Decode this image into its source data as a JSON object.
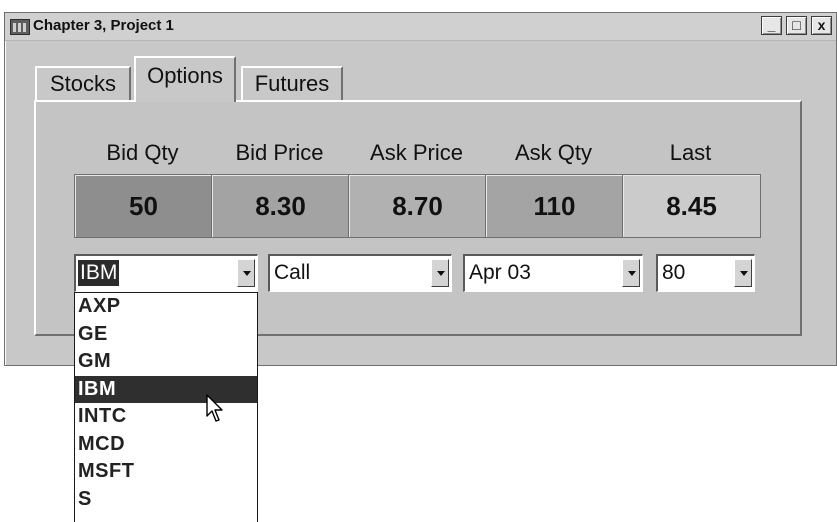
{
  "window": {
    "title": "Chapter 3, Project 1",
    "controls": {
      "minimize": "_",
      "maximize": "□",
      "close": "x"
    }
  },
  "tabs": [
    {
      "label": "Stocks",
      "active": false
    },
    {
      "label": "Options",
      "active": true
    },
    {
      "label": "Futures",
      "active": false
    }
  ],
  "quote": {
    "headers": [
      "Bid Qty",
      "Bid Price",
      "Ask Price",
      "Ask Qty",
      "Last"
    ],
    "values": [
      "50",
      "8.30",
      "8.70",
      "110",
      "8.45"
    ],
    "cell_colors": [
      "#8e8e8e",
      "#a3a3a3",
      "#b1b1b1",
      "#a4a4a4",
      "#cbcbcb"
    ]
  },
  "selectors": {
    "symbol": "IBM",
    "option_type": "Call",
    "expiration": "Apr 03",
    "strike": "80"
  },
  "symbol_dropdown": {
    "items": [
      "AXP",
      "GE",
      "GM",
      "IBM",
      "INTC",
      "MCD",
      "MSFT",
      "S"
    ],
    "highlighted": "IBM"
  },
  "icons": {
    "app": "app-icon",
    "cursor": "mouse-pointer-icon",
    "combo_arrow": "chevron-down-icon"
  }
}
